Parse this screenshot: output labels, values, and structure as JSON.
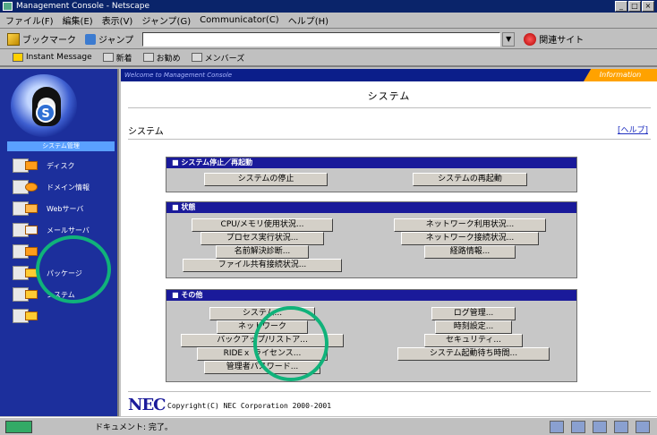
{
  "window": {
    "title": "Management Console - Netscape"
  },
  "menu": [
    "ファイル(F)",
    "編集(E)",
    "表示(V)",
    "ジャンプ(G)",
    "Communicator(C)",
    "ヘルプ(H)"
  ],
  "navbar": {
    "bookmarks": "ブックマーク",
    "jump": "ジャンプ",
    "url": "",
    "related": "関連サイト"
  },
  "personal_toolbar": [
    "Instant Message",
    "新着",
    "お勧め",
    "メンバーズ"
  ],
  "sidebar": {
    "section": "システム管理",
    "items": [
      {
        "label": "ディスク",
        "icon": "disk-icon"
      },
      {
        "label": "ドメイン情報",
        "icon": "domain-icon"
      },
      {
        "label": "Webサーバ",
        "icon": "web-server-icon"
      },
      {
        "label": "メールサーバ",
        "icon": "mail-server-icon"
      },
      {
        "label": "",
        "icon": "tool-icon"
      },
      {
        "label": "パッケージ",
        "icon": "package-icon"
      },
      {
        "label": "システム",
        "icon": "system-icon"
      },
      {
        "label": "",
        "icon": "admin-icon"
      }
    ]
  },
  "main": {
    "banner": "Welcome to Management Console",
    "info_tab": "Information",
    "title": "システム",
    "breadcrumb": "システム",
    "help": "[ヘルプ]",
    "sections": {
      "shutdown": {
        "title": "■ システム停止／再起動",
        "buttons": [
          "システムの停止",
          "システムの再起動"
        ]
      },
      "status": {
        "title": "■ 状態",
        "left": [
          "CPU/メモリ使用状況...",
          "プロセス実行状況...",
          "名前解決診断...",
          "ファイル共有接続状況..."
        ],
        "right": [
          "ネットワーク利用状況...",
          "ネットワーク接続状況...",
          "経路情報..."
        ]
      },
      "other": {
        "title": "■ その他",
        "left": [
          "システム...",
          "ネットワーク",
          "バックアップ/リストア...",
          "RIDEｘ ライセンス...",
          "管理者パスワード..."
        ],
        "right": [
          "ログ管理...",
          "時刻設定...",
          "セキュリティ...",
          "システム起動待ち時間..."
        ]
      }
    },
    "copyright": "Copyright(C) NEC Corporation 2000-2001",
    "nec_logo": "NEC"
  },
  "statusbar": {
    "text": "ドキュメント: 完了。"
  },
  "colors": {
    "sidebar_bg": "#1c2f9c",
    "panel_header": "#1a1a9a",
    "highlight": "#10b27a",
    "accent": "#ffa200"
  }
}
